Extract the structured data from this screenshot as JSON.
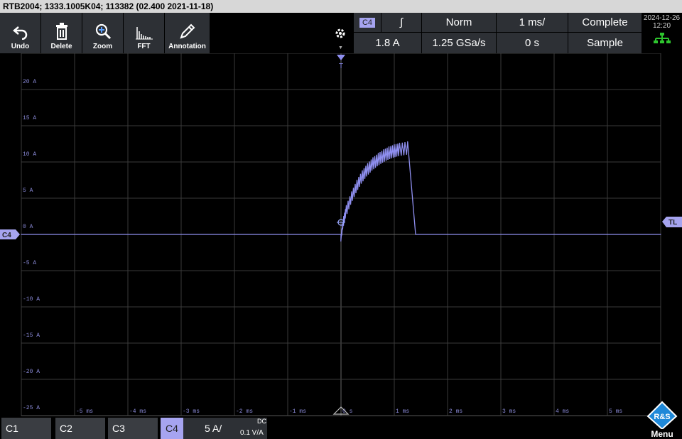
{
  "window": {
    "title": "RTB2004; 1333.1005K04; 113382 (02.400 2021-11-18)"
  },
  "toolbar": {
    "undo": "Undo",
    "delete": "Delete",
    "zoom": "Zoom",
    "fft": "FFT",
    "annotation": "Annotation"
  },
  "trigger": {
    "source": "C4",
    "slope_symbol": "∫",
    "level": "1.8 A",
    "mode": "Norm",
    "samplerate": "1.25 GSa/s",
    "timebase": "1 ms/",
    "position": "0 s",
    "acq_state": "Complete",
    "acq_mode": "Sample"
  },
  "datetime": {
    "date": "2024-12-26",
    "time": "12:20"
  },
  "plot": {
    "channel_marker": "C4",
    "trigger_level_marker": "TL",
    "trigger_time_marker": "T"
  },
  "channels": {
    "c1": "C1",
    "c2": "C2",
    "c3": "C3",
    "c4": "C4",
    "c4_scale": "5 A/",
    "c4_coupling": "DC",
    "c4_probe": "0.1 V/A"
  },
  "menu": {
    "label": "Menu",
    "logo_text": "R&S"
  },
  "chart_data": {
    "type": "line",
    "y_tick_labels": [
      "20 A",
      "15 A",
      "10 A",
      "5 A",
      "0 A",
      "-5 A",
      "-10 A",
      "-15 A",
      "-20 A",
      "-25 A"
    ],
    "x_tick_labels": [
      "-5 ms",
      "-4 ms",
      "-3 ms",
      "-2 ms",
      "-1 ms",
      "0 s",
      "1 ms",
      "2 ms",
      "3 ms",
      "4 ms",
      "5 ms"
    ],
    "ylim": [
      -25,
      25
    ],
    "xlim": [
      -6,
      6
    ],
    "series": [
      {
        "color": "#8f8ff0",
        "x": [
          -6,
          0,
          0.05,
          0.1,
          0.2,
          0.3,
          0.4,
          0.5,
          0.6,
          0.7,
          0.8,
          0.9,
          1.0,
          1.1,
          1.25,
          1.4,
          6
        ],
        "y": [
          0,
          0,
          2.5,
          4.0,
          5.9,
          7.5,
          8.8,
          9.8,
          10.6,
          11.2,
          11.7,
          12.1,
          12.4,
          12.6,
          12.8,
          0,
          0
        ]
      }
    ],
    "grid": true
  },
  "colors": {
    "trace": "#8f8ff0",
    "grid": "#3a3a3a",
    "panel": "#2d3035",
    "channel4": "#a6a4f0"
  }
}
